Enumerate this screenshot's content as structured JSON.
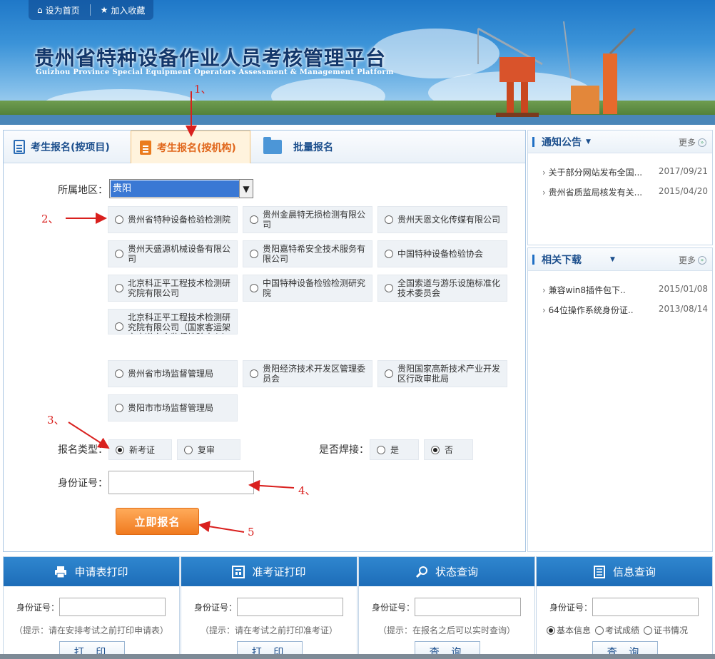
{
  "topbar": {
    "home_label": "设为首页",
    "fav_label": "加入收藏"
  },
  "header": {
    "title_cn": "贵州省特种设备作业人员考核管理平台",
    "title_en": "Guizhou Province Special Equipment Operators Assessment & Management Platform"
  },
  "tabs": [
    {
      "label": "考生报名(按项目)",
      "active": false,
      "icon": "document-icon"
    },
    {
      "label": "考生报名(按机构)",
      "active": true,
      "icon": "document-icon"
    },
    {
      "label": "批量报名",
      "active": false,
      "icon": "folder-icon"
    }
  ],
  "form": {
    "region_label": "所属地区：",
    "region_value": "贵阳",
    "orgs": [
      {
        "name": "贵州省特种设备检验检测院",
        "selected": false
      },
      {
        "name": "贵州金晨特无损检测有限公司",
        "selected": false
      },
      {
        "name": "贵州天恩文化传媒有限公司",
        "selected": false
      },
      {
        "name": "贵州天盛源机械设备有限公司",
        "selected": false
      },
      {
        "name": "贵阳嘉特希安全技术服务有限公司",
        "selected": false
      },
      {
        "name": "中国特种设备检验协会",
        "selected": false
      },
      {
        "name": "北京科正平工程技术检测研究院有限公司",
        "selected": false
      },
      {
        "name": "中国特种设备检验检测研究院",
        "selected": false
      },
      {
        "name": "全国索道与游乐设施标准化技术委员会",
        "selected": false
      },
      {
        "name": "北京科正平工程技术检测研究院有限公司（国家客运架空索道安全监督检验中心）",
        "selected": false
      },
      {
        "name": "贵州省市场监督管理局",
        "selected": false
      },
      {
        "name": "贵阳经济技术开发区管理委员会",
        "selected": false
      },
      {
        "name": "贵阳国家高新技术产业开发区行政审批局",
        "selected": false
      },
      {
        "name": "贵阳市市场监督管理局",
        "selected": false
      }
    ],
    "type_label": "报名类型：",
    "type_options": [
      {
        "label": "新考证",
        "selected": true
      },
      {
        "label": "复审",
        "selected": false
      }
    ],
    "weld_label": "是否焊接：",
    "weld_options": [
      {
        "label": "是",
        "selected": false
      },
      {
        "label": "否",
        "selected": true
      }
    ],
    "id_label": "身份证号：",
    "id_value": "",
    "submit_label": "立即报名"
  },
  "annotations": [
    "1、",
    "2、",
    "3、",
    "4、",
    "5"
  ],
  "notices": {
    "title": "通知公告",
    "more": "更多",
    "items": [
      {
        "text": "关于部分网站发布全国...",
        "date": "2017/09/21"
      },
      {
        "text": "贵州省质监局核发有关...",
        "date": "2015/04/20"
      }
    ]
  },
  "downloads": {
    "title": "相关下载",
    "more": "更多",
    "items": [
      {
        "text": "兼容win8插件包下..",
        "date": "2015/01/08"
      },
      {
        "text": "64位操作系统身份证..",
        "date": "2013/08/14"
      }
    ]
  },
  "bottom": [
    {
      "title": "申请表打印",
      "icon": "printer-icon",
      "id_label": "身份证号：",
      "hint": "（提示：请在安排考试之前打印申请表）",
      "button": "打 印"
    },
    {
      "title": "准考证打印",
      "icon": "card-icon",
      "id_label": "身份证号：",
      "hint": "（提示：请在考试之前打印准考证）",
      "button": "打 印"
    },
    {
      "title": "状态查询",
      "icon": "search-icon",
      "id_label": "身份证号：",
      "hint": "（提示：在报名之后可以实时查询）",
      "button": "查 询"
    },
    {
      "title": "信息查询",
      "icon": "list-icon",
      "id_label": "身份证号：",
      "radios": [
        {
          "label": "基本信息",
          "selected": true
        },
        {
          "label": "考试成绩",
          "selected": false
        },
        {
          "label": "证书情况",
          "selected": false
        }
      ],
      "button": "查 询"
    }
  ],
  "colors": {
    "primary": "#1d6db8",
    "accent": "#f07a1f",
    "annotation": "#d9201e"
  }
}
